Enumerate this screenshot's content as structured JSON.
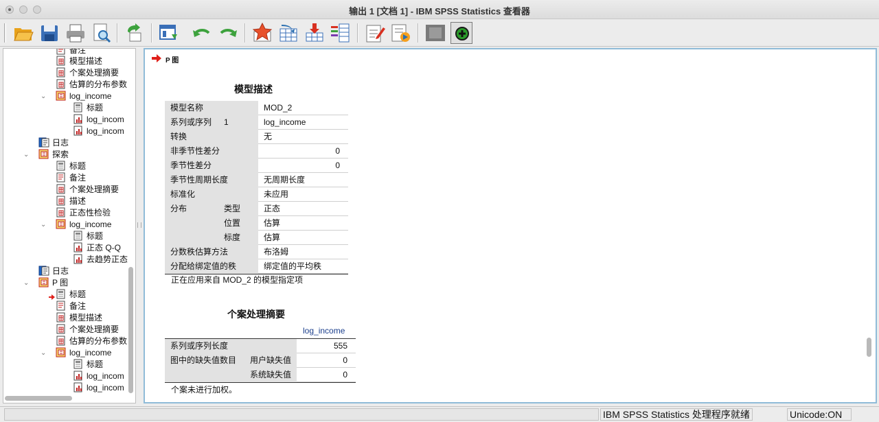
{
  "window": {
    "title": "输出 1 [文档 1] - IBM SPSS Statistics 查看器"
  },
  "toolbar": {
    "buttons": [
      "open-icon",
      "save-icon",
      "print-icon",
      "print-preview-icon",
      "export-icon",
      "recall-dialog-icon",
      "undo-icon",
      "redo-icon",
      "goto-data-icon",
      "goto-case-icon",
      "goto-variable-icon",
      "variables-icon",
      "insert-heading-icon",
      "insert-title-icon",
      "designate-window-icon",
      "add-icon"
    ]
  },
  "outline": {
    "items": [
      {
        "label": "备注",
        "icon": "notes-icon"
      },
      {
        "label": "模型描述",
        "icon": "table-icon"
      },
      {
        "label": "个案处理摘要",
        "icon": "table-icon"
      },
      {
        "label": "估算的分布参数",
        "icon": "table-icon"
      },
      {
        "label": "log_income",
        "icon": "book-icon"
      },
      {
        "label": "标题",
        "icon": "title-icon"
      },
      {
        "label": "log_incom",
        "icon": "chart-icon"
      },
      {
        "label": "log_incom",
        "icon": "chart-icon"
      },
      {
        "label": "日志",
        "icon": "log-icon"
      },
      {
        "label": "探索",
        "icon": "book-icon"
      },
      {
        "label": "标题",
        "icon": "title-icon"
      },
      {
        "label": "备注",
        "icon": "notes-icon"
      },
      {
        "label": "个案处理摘要",
        "icon": "table-icon"
      },
      {
        "label": "描述",
        "icon": "table-icon"
      },
      {
        "label": "正态性检验",
        "icon": "table-icon"
      },
      {
        "label": "log_income",
        "icon": "book-icon"
      },
      {
        "label": "标题",
        "icon": "title-icon"
      },
      {
        "label": "正态 Q-Q",
        "icon": "chart-icon"
      },
      {
        "label": "去趋势正态",
        "icon": "chart-icon"
      },
      {
        "label": "日志",
        "icon": "log-icon"
      },
      {
        "label": "P 图",
        "icon": "book-icon"
      },
      {
        "label": "标题",
        "icon": "title-icon"
      },
      {
        "label": "备注",
        "icon": "notes-icon"
      },
      {
        "label": "模型描述",
        "icon": "table-icon"
      },
      {
        "label": "个案处理摘要",
        "icon": "table-icon"
      },
      {
        "label": "估算的分布参数",
        "icon": "table-icon"
      },
      {
        "label": "log_income",
        "icon": "book-icon"
      },
      {
        "label": "标题",
        "icon": "title-icon"
      },
      {
        "label": "log_incom",
        "icon": "chart-icon"
      },
      {
        "label": "log_incom",
        "icon": "chart-icon"
      }
    ]
  },
  "content": {
    "procedure_title": "P 图",
    "model_desc": {
      "title": "模型描述",
      "rows": [
        {
          "label": "模型名称",
          "sub": "",
          "value": "MOD_2"
        },
        {
          "label": "系列或序列",
          "sub": "1",
          "value": "log_income"
        },
        {
          "label": "转换",
          "sub": "",
          "value": "无"
        },
        {
          "label": "非季节性差分",
          "sub": "",
          "value": "0"
        },
        {
          "label": "季节性差分",
          "sub": "",
          "value": "0"
        },
        {
          "label": "季节性周期长度",
          "sub": "",
          "value": "无周期长度"
        },
        {
          "label": "标准化",
          "sub": "",
          "value": "未应用"
        },
        {
          "label": "分布",
          "sub": "类型",
          "value": "正态"
        },
        {
          "label": "",
          "sub": "位置",
          "value": "估算"
        },
        {
          "label": "",
          "sub": "标度",
          "value": "估算"
        },
        {
          "label": "分数秩估算方法",
          "sub": "",
          "value": "布洛姆"
        },
        {
          "label": "分配给绑定值的秩",
          "sub": "",
          "value": "绑定值的平均秩"
        }
      ],
      "footnote": "正在应用来自 MOD_2 的模型指定项"
    },
    "case_summary": {
      "title": "个案处理摘要",
      "column": "log_income",
      "rows": [
        {
          "label": "系列或序列长度",
          "sub": "",
          "value": "555"
        },
        {
          "label": "图中的缺失值数目",
          "sub": "用户缺失值",
          "value": "0"
        },
        {
          "label": "",
          "sub": "系统缺失值",
          "value": "0"
        }
      ],
      "footnote": "个案未进行加权。"
    }
  },
  "status": {
    "message": "IBM SPSS Statistics 处理程序就绪",
    "encoding": "Unicode:ON"
  }
}
